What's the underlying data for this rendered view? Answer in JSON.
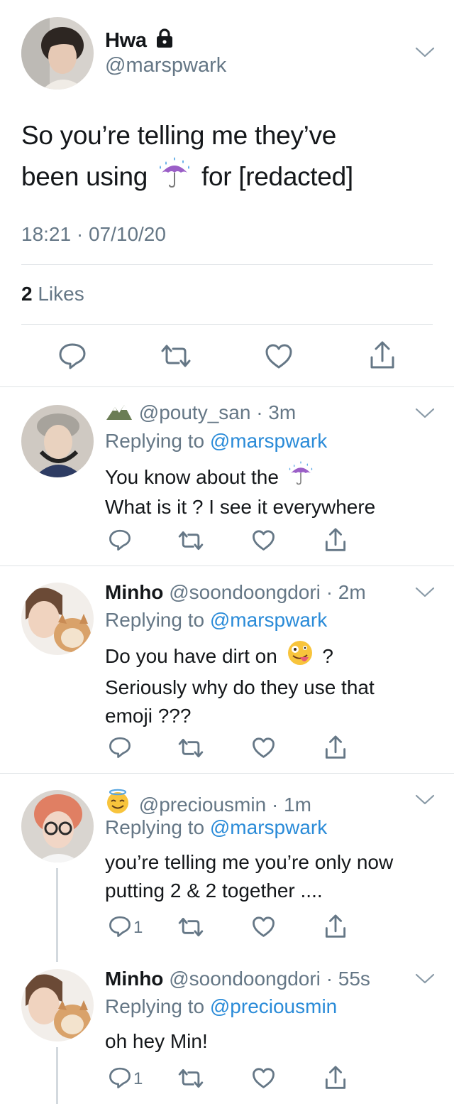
{
  "main_tweet": {
    "name": "Hwa",
    "handle": "@marspwark",
    "text_line1": "So you’re telling me they’ve",
    "text_line2a": "been using",
    "text_line2b": "for [redacted]",
    "emoji_umbrella": "umbrella-with-rain-icon",
    "timestamp": "18:21 · 07/10/20",
    "likes_count": "2",
    "likes_label": "Likes"
  },
  "replies": [
    {
      "name": "",
      "name_emoji": "mountain-icon",
      "handle": "@pouty_san",
      "time": "· 3m",
      "replying_prefix": "Replying to",
      "replying_to": "@marspwark",
      "line1": "You know about the",
      "line1_emoji": "umbrella-with-rain-icon",
      "line2": "What is it ? I see it everywhere",
      "reply_count": ""
    },
    {
      "name": "Minho",
      "handle": "@soondoongdori",
      "time": "· 2m",
      "replying_prefix": "Replying to",
      "replying_to": "@marspwark",
      "line1": "Do you have dirt on",
      "line1_emoji": "zany-face-icon",
      "line1_suffix": "?",
      "line2": "Seriously why do they use that",
      "line3": "emoji ???",
      "reply_count": ""
    },
    {
      "name": "",
      "name_emoji": "halo-face-icon",
      "handle": "@preciousmin",
      "time": "· 1m",
      "replying_prefix": "Replying to",
      "replying_to": "@marspwark",
      "line1": "you’re telling me you’re only now",
      "line2": "putting 2 & 2 together ....",
      "reply_count": "1"
    },
    {
      "name": "Minho",
      "handle": "@soondoongdori",
      "time": "· 55s",
      "replying_prefix": "Replying to",
      "replying_to": "@preciousmin",
      "line1": "oh hey Min!",
      "reply_count": "1"
    }
  ],
  "colors": {
    "text": "#14171a",
    "secondary": "#657786",
    "link": "#2a8bd8",
    "divider": "#dfe3e6"
  }
}
